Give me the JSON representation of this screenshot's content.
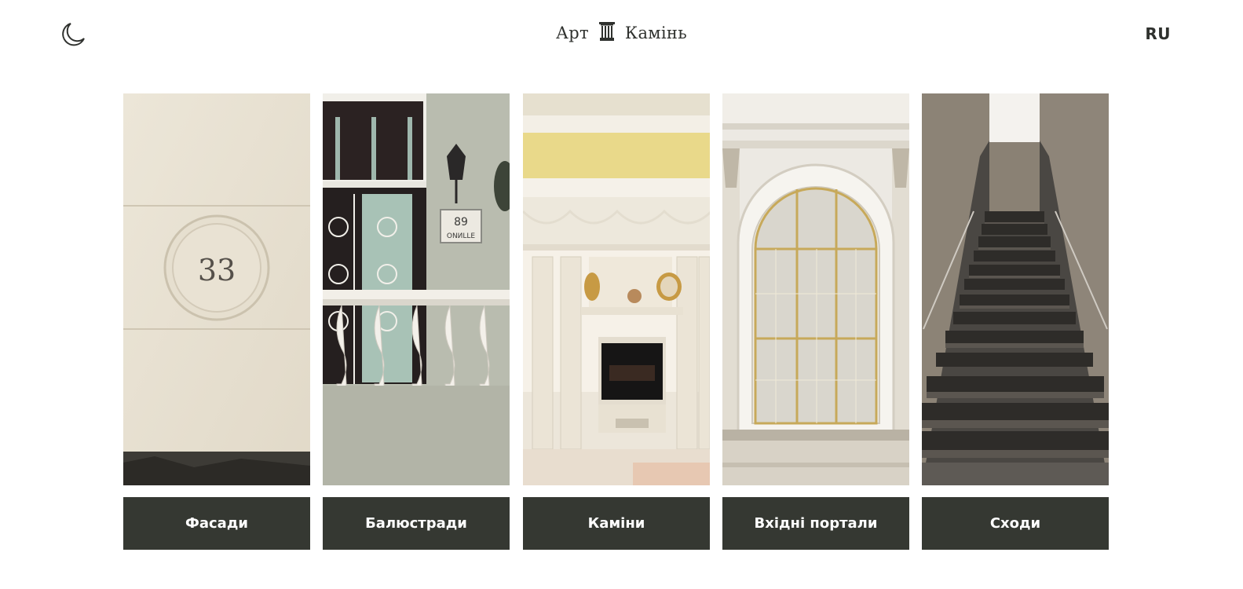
{
  "header": {
    "theme_toggle_icon": "moon-icon",
    "logo_left": "Арт",
    "logo_icon": "column-icon",
    "logo_right": "Камінь",
    "lang_label": "RU"
  },
  "categories": [
    {
      "label": "Фасади",
      "house_number": "33",
      "image": "facade-photo"
    },
    {
      "label": "Балюстради",
      "sign_text": "89",
      "sign_text_2": "ОNИLLE",
      "image": "balustrade-photo"
    },
    {
      "label": "Каміни",
      "image": "fireplace-photo"
    },
    {
      "label": "Вхідні портали",
      "image": "portal-photo"
    },
    {
      "label": "Сходи",
      "image": "stairs-photo"
    }
  ],
  "colors": {
    "button_bg": "#353832",
    "button_text": "#ffffff",
    "text": "#2f312e"
  }
}
